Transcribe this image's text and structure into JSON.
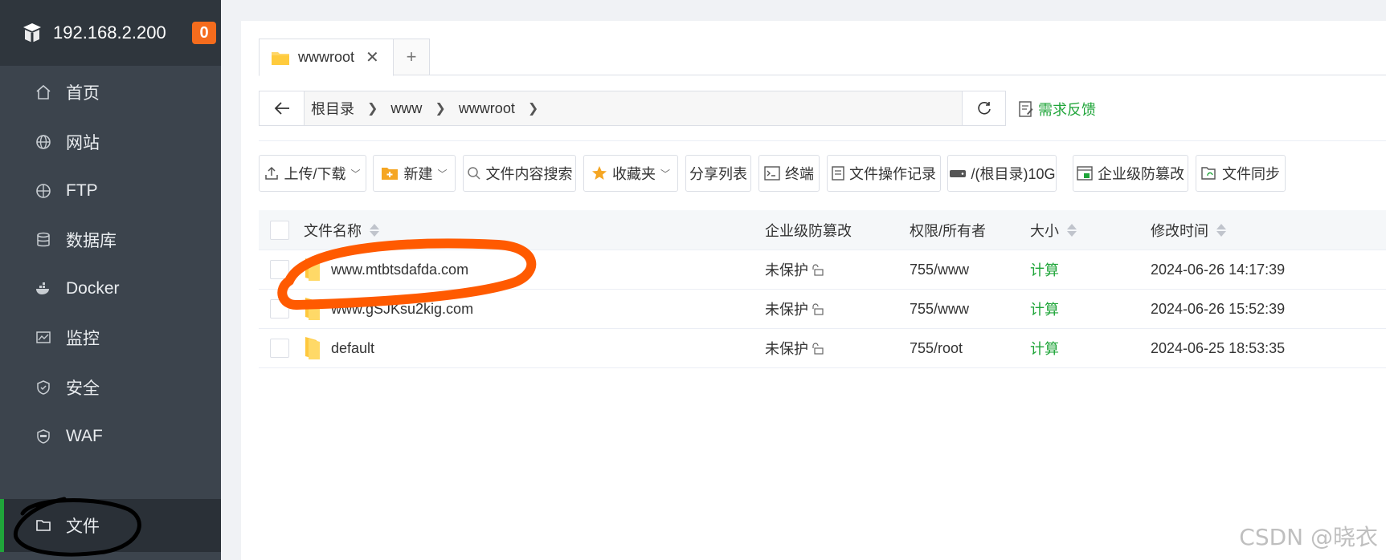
{
  "sidebar": {
    "host": "192.168.2.200",
    "badge": "0",
    "items": [
      {
        "label": "首页",
        "icon": "home-icon"
      },
      {
        "label": "网站",
        "icon": "globe-icon"
      },
      {
        "label": "FTP",
        "icon": "ftp-icon"
      },
      {
        "label": "数据库",
        "icon": "database-icon"
      },
      {
        "label": "Docker",
        "icon": "docker-icon"
      },
      {
        "label": "监控",
        "icon": "monitor-icon"
      },
      {
        "label": "安全",
        "icon": "shield-icon"
      },
      {
        "label": "WAF",
        "icon": "waf-icon"
      },
      {
        "label": "文件",
        "icon": "folder-icon",
        "active": true
      }
    ]
  },
  "tabs": {
    "current": "wwwroot",
    "add": "+"
  },
  "path": {
    "crumbs": [
      "根目录",
      "www",
      "wwwroot"
    ],
    "feedback": "需求反馈"
  },
  "toolbar": {
    "upload": "上传/下载",
    "new": "新建",
    "content_search": "文件内容搜索",
    "favorites": "收藏夹",
    "share_list": "分享列表",
    "terminal": "终端",
    "op_log": "文件操作记录",
    "disk": "/(根目录)10G",
    "tamper": "企业级防篡改",
    "sync": "文件同步"
  },
  "table": {
    "headers": {
      "name": "文件名称",
      "protect": "企业级防篡改",
      "perm": "权限/所有者",
      "size": "大小",
      "mtime": "修改时间"
    },
    "rows": [
      {
        "name": "www.mtbtsdafda.com",
        "protect": "未保护",
        "perm": "755/www",
        "size": "计算",
        "mtime": "2024-06-26 14:17:39"
      },
      {
        "name": "www.gSJKsu2kig.com",
        "protect": "未保护",
        "perm": "755/www",
        "size": "计算",
        "mtime": "2024-06-26 15:52:39"
      },
      {
        "name": "default",
        "protect": "未保护",
        "perm": "755/root",
        "size": "计算",
        "mtime": "2024-06-25 18:53:35"
      }
    ]
  },
  "watermark": "CSDN @晓衣",
  "colors": {
    "accent": "#20a53a",
    "sidebar": "#3c444d",
    "badge": "#f56c1d",
    "annotation_orange": "#ff5a00"
  }
}
